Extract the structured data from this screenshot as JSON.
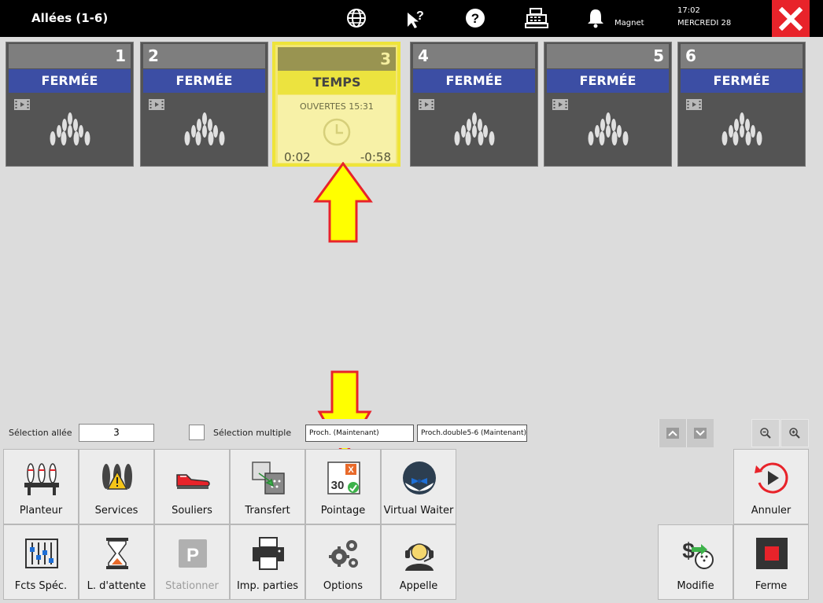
{
  "header": {
    "title": "Allées (1-6)",
    "magnet_label": "Magnet",
    "time": "17:02",
    "date": "MERCREDI 28"
  },
  "lanes": [
    {
      "number": "1",
      "status": "FERMÉE"
    },
    {
      "number": "2",
      "status": "FERMÉE"
    },
    {
      "number": "3",
      "status": "TEMPS",
      "opened": "OUVERTES 15:31",
      "elapsed": "0:02",
      "remaining": "-0:58"
    },
    {
      "number": "4",
      "status": "FERMÉE"
    },
    {
      "number": "5",
      "status": "FERMÉE"
    },
    {
      "number": "6",
      "status": "FERMÉE"
    }
  ],
  "selection": {
    "label": "Sélection allée",
    "value": "3",
    "multi_label": "Sélection multiple",
    "chip1": "Proch. (Maintenant)",
    "chip2": "Proch.double5-6 (Maintenant)"
  },
  "buttons": {
    "planteur": "Planteur",
    "services": "Services",
    "souliers": "Souliers",
    "transfert": "Transfert",
    "pointage": "Pointage",
    "virtual_waiter": "Virtual Waiter",
    "annuler": "Annuler",
    "fcts_spec": "Fcts Spéc.",
    "attente": "L. d'attente",
    "stationner": "Stationner",
    "imp_parties": "Imp. parties",
    "options": "Options",
    "appelle": "Appelle",
    "modifie": "Modifie",
    "ferme": "Ferme"
  },
  "colors": {
    "closed_status": "#3c4ea4",
    "active_lane": "#f3e775",
    "close_red": "#e8232a",
    "arrow_yellow": "#ffff00",
    "arrow_red": "#e8232a"
  }
}
